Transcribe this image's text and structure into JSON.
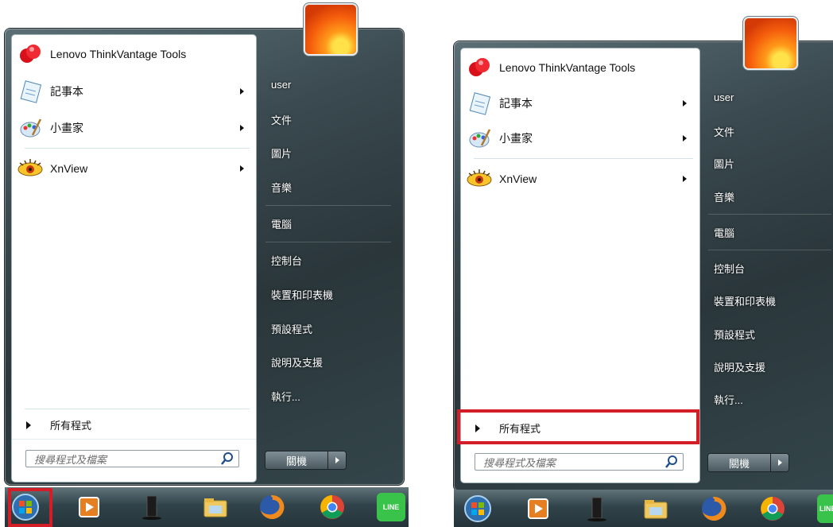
{
  "menus": [
    {
      "programs": [
        {
          "name": "Lenovo ThinkVantage Tools",
          "icon": "lenovo-tools-icon",
          "submenu": false
        },
        {
          "name": "記事本",
          "icon": "notepad-icon",
          "submenu": true
        },
        {
          "name": "小畫家",
          "icon": "paint-icon",
          "submenu": true
        },
        {
          "name": "XnView",
          "icon": "xnview-icon",
          "submenu": true
        }
      ],
      "all_programs": "所有程式",
      "search_placeholder": "搜尋程式及檔案",
      "right_items": [
        "user",
        "文件",
        "圖片",
        "音樂",
        "電腦",
        "控制台",
        "裝置和印表機",
        "預設程式",
        "說明及支援",
        "執行..."
      ],
      "shutdown_label": "關機"
    },
    {
      "programs": [
        {
          "name": "Lenovo ThinkVantage Tools",
          "icon": "lenovo-tools-icon",
          "submenu": false
        },
        {
          "name": "記事本",
          "icon": "notepad-icon",
          "submenu": true
        },
        {
          "name": "小畫家",
          "icon": "paint-icon",
          "submenu": true
        },
        {
          "name": "XnView",
          "icon": "xnview-icon",
          "submenu": true
        }
      ],
      "all_programs": "所有程式",
      "search_placeholder": "搜尋程式及檔案",
      "right_items": [
        "user",
        "文件",
        "圖片",
        "音樂",
        "電腦",
        "控制台",
        "裝置和印表機",
        "預設程式",
        "說明及支援",
        "執行..."
      ],
      "shutdown_label": "關機"
    }
  ],
  "taskbar_icons": [
    "windows-start-orb-icon",
    "media-player-icon",
    "computer-tower-icon",
    "file-explorer-icon",
    "firefox-icon",
    "chrome-icon",
    "line-icon"
  ],
  "taskbar_line_label": "LINE",
  "colors": {
    "highlight": "#d31d27",
    "menu_frame": "#3a4a50",
    "right_text": "#ffffff"
  }
}
